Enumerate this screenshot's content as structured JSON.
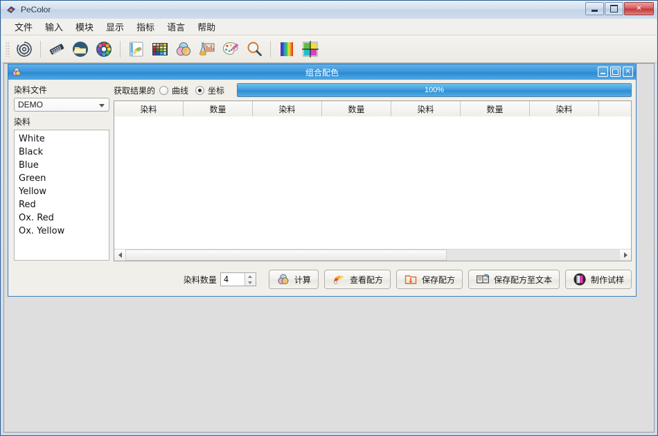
{
  "window": {
    "title": "PeColor",
    "app_icon": "pecolor-logo-icon",
    "controls": {
      "minimize": "minimize-button",
      "maximize": "maximize-button",
      "close": "close-button"
    }
  },
  "menu": {
    "items": [
      {
        "label": "文件",
        "name": "menu-file"
      },
      {
        "label": "输入",
        "name": "menu-input"
      },
      {
        "label": "模块",
        "name": "menu-module"
      },
      {
        "label": "显示",
        "name": "menu-display"
      },
      {
        "label": "指标",
        "name": "menu-index"
      },
      {
        "label": "语言",
        "name": "menu-language"
      },
      {
        "label": "帮助",
        "name": "menu-help"
      }
    ]
  },
  "toolbar": {
    "buttons": [
      {
        "name": "settings-gear-icon",
        "icon": "gear-refresh"
      },
      {
        "name": "spectrophotometer-icon",
        "icon": "keyboard-device"
      },
      {
        "name": "open-folder-icon",
        "icon": "folder"
      },
      {
        "name": "color-wheel-icon",
        "icon": "color-wheel"
      },
      {
        "name": "color-swatch-fan-icon",
        "icon": "swatch-fan"
      },
      {
        "name": "color-palette-grid-icon",
        "icon": "palette-grid"
      },
      {
        "name": "color-mixing-icon",
        "icon": "venn-circles"
      },
      {
        "name": "lab-beaker-icon",
        "icon": "lab-beaker"
      },
      {
        "name": "artist-palette-icon",
        "icon": "artist-palette"
      },
      {
        "name": "search-magnifier-icon",
        "icon": "magnifier"
      },
      {
        "name": "spectrum-bar-icon",
        "icon": "spectrum-bar"
      },
      {
        "name": "color-grid-icon",
        "icon": "color-grid"
      }
    ]
  },
  "child_window": {
    "title": "组合配色",
    "icon": "combination-color-icon",
    "controls": {
      "minimize": "minimize-button",
      "maximize": "maximize-button",
      "close": "close-button"
    },
    "left_panel": {
      "file_label": "染料文件",
      "file_combo_value": "DEMO",
      "dye_label": "染料",
      "dye_list": [
        "White",
        "Black",
        "Blue",
        "Green",
        "Yellow",
        "Red",
        "Ox. Red",
        "Ox. Yellow"
      ]
    },
    "options": {
      "result_label": "获取结果的",
      "radio_curve": {
        "label": "曲线",
        "selected": false
      },
      "radio_coordinate": {
        "label": "坐标",
        "selected": true
      }
    },
    "progress": {
      "value": 100,
      "text": "100%",
      "fill_color": "#3f9ede"
    },
    "table": {
      "columns": [
        "染料",
        "数量",
        "染料",
        "数量",
        "染料",
        "数量",
        "染料",
        ""
      ],
      "rows": []
    },
    "bottom_bar": {
      "count_label": "染料数量",
      "count_value": "4",
      "buttons": [
        {
          "label": "计算",
          "name": "calculate-button",
          "icon": "venn-circles-icon"
        },
        {
          "label": "查看配方",
          "name": "view-formula-button",
          "icon": "swatch-fan-icon"
        },
        {
          "label": "保存配方",
          "name": "save-formula-button",
          "icon": "save-download-icon"
        },
        {
          "label": "保存配方至文本",
          "name": "save-formula-text-button",
          "icon": "book-export-icon"
        },
        {
          "label": "制作试样",
          "name": "make-sample-button",
          "icon": "sample-swatch-icon"
        }
      ]
    }
  }
}
